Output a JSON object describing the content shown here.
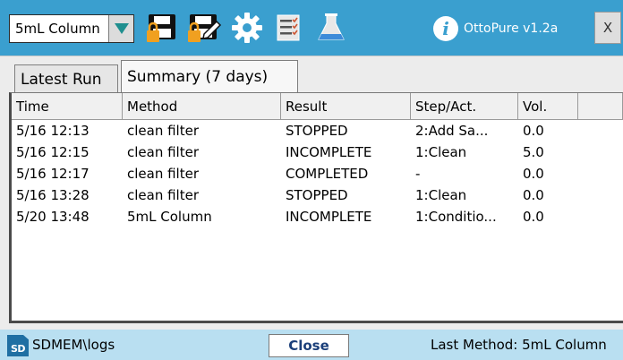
{
  "toolbar": {
    "method_selected": "5mL Column",
    "icons": [
      "dropdown-arrow-icon",
      "lock-save-icon",
      "lock-edit-icon",
      "settings-gear-icon",
      "checklist-icon",
      "flask-icon"
    ],
    "app_name": "OttoPure v1.2a",
    "close_label": "X",
    "colors": {
      "bar": "#3a9fcf",
      "accent": "#1f8f8f",
      "lock": "#f0a020"
    }
  },
  "tabs": [
    {
      "label": "Latest Run",
      "active": false
    },
    {
      "label": "Summary (7 days)",
      "active": true
    }
  ],
  "table": {
    "columns": [
      "Time",
      "Method",
      "Result",
      "Step/Act.",
      "Vol."
    ],
    "rows": [
      [
        "5/16 12:13",
        "clean filter",
        "STOPPED",
        "2:Add Sa...",
        "0.0"
      ],
      [
        "5/16 12:15",
        "clean filter",
        "INCOMPLETE",
        "1:Clean",
        "5.0"
      ],
      [
        "5/16 12:17",
        "clean filter",
        "COMPLETED",
        "-",
        "0.0"
      ],
      [
        "5/16 13:28",
        "clean filter",
        "STOPPED",
        "1:Clean",
        "0.0"
      ],
      [
        "5/20 13:48",
        "5mL Column",
        "INCOMPLETE",
        "1:Conditio...",
        "0.0"
      ]
    ]
  },
  "status": {
    "path": "SDMEM\\logs",
    "sd_badge": "SD",
    "close_button": "Close",
    "last_method": "Last Method: 5mL Column"
  }
}
